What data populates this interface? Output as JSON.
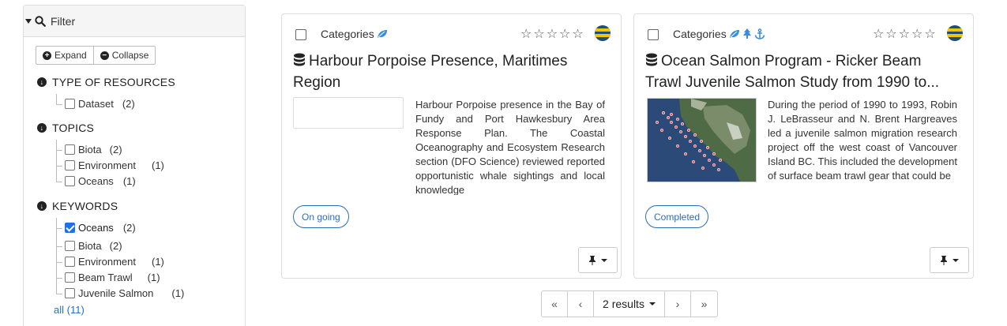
{
  "filter": {
    "title": "Filter",
    "expand_label": "Expand",
    "collapse_label": "Collapse",
    "sections": [
      {
        "title": "TYPE OF RESOURCES",
        "items": [
          {
            "label": "Dataset",
            "count": "(2)",
            "checked": false
          }
        ]
      },
      {
        "title": "TOPICS",
        "items": [
          {
            "label": "Biota",
            "count": "(2)",
            "checked": false
          },
          {
            "label": "Environment",
            "count": "(1)",
            "checked": false
          },
          {
            "label": "Oceans",
            "count": "(1)",
            "checked": false
          }
        ]
      },
      {
        "title": "KEYWORDS",
        "items": [
          {
            "label": "Oceans",
            "count": "(2)",
            "checked": true
          },
          {
            "label": "Biota",
            "count": "(2)",
            "checked": false
          },
          {
            "label": "Environment",
            "count": "(1)",
            "checked": false
          },
          {
            "label": "Beam Trawl",
            "count": "(1)",
            "checked": false
          },
          {
            "label": "Juvenile Salmon",
            "count": "(1)",
            "checked": false
          }
        ]
      }
    ],
    "all_link": "all (11)"
  },
  "cards": [
    {
      "category_label": "Categories",
      "category_icons": [
        "leaf-icon"
      ],
      "title": "Harbour Porpoise Presence, Maritimes Region",
      "abstract": "Harbour Porpoise presence in the Bay of Fundy and Port Hawkesbury Area Response Plan. The Coastal Oceanography and Ecosystem Research section (DFO Science) reviewed reported opportunistic whale sightings and local knowledge",
      "status": "On going",
      "rating": 0
    },
    {
      "category_label": "Categories",
      "category_icons": [
        "leaf-icon",
        "tree-icon",
        "anchor-icon"
      ],
      "title": "Ocean Salmon Program - Ricker Beam Trawl Juvenile Salmon Study from 1990 to...",
      "abstract": "During the period of 1990 to 1993, Robin J. LeBrasseur and N. Brent Hargreaves led a juvenile salmon migration research project off the west coast of Vancouver Island BC. This included the development of surface beam trawl gear that could be",
      "status": "Completed",
      "rating": 0
    }
  ],
  "pagination": {
    "first": "«",
    "prev": "‹",
    "results_label": "2 results",
    "next": "›",
    "last": "»"
  },
  "colors": {
    "accent": "#2a6ebb",
    "checkbox_checked": "#1a73e8",
    "badge_blue": "#1d4f7c",
    "badge_yellow": "#f2c400"
  }
}
